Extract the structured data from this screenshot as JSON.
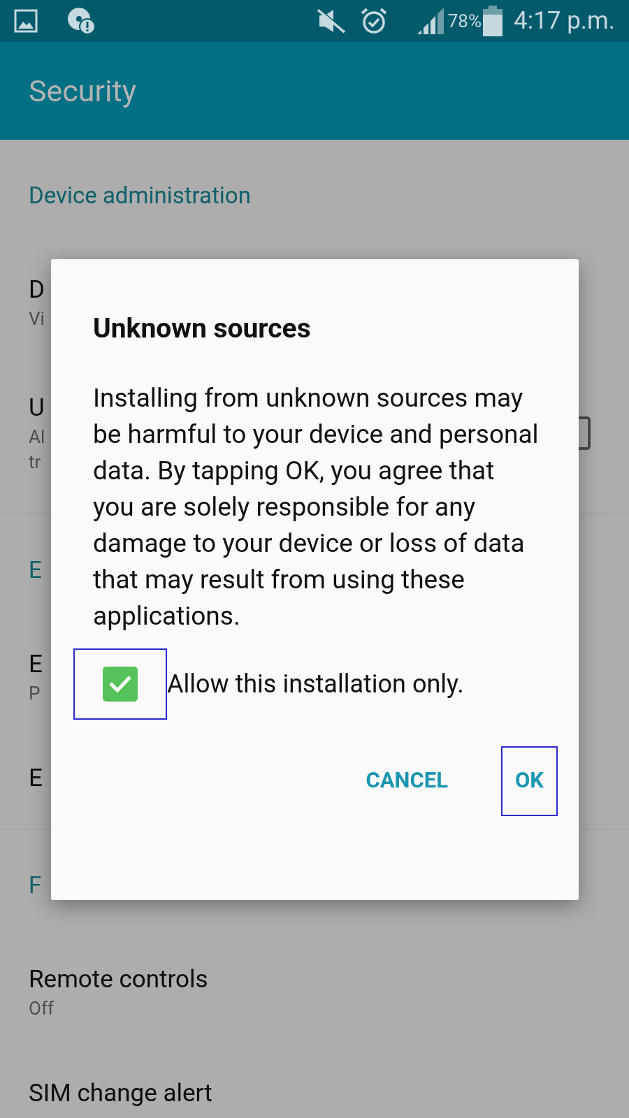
{
  "status_bar": {
    "battery": "78%",
    "time": "4:17 p.m."
  },
  "app_bar": {
    "title": "Security"
  },
  "settings": [
    {
      "kind": "header",
      "title": "Device administration"
    },
    {
      "kind": "row",
      "title": "D",
      "subtitle": "Vi"
    },
    {
      "kind": "checkbox-row",
      "title": "U",
      "subtitle_lines": [
        "Al",
        "tr"
      ],
      "checked": false
    },
    {
      "kind": "divider"
    },
    {
      "kind": "header",
      "title": "E"
    },
    {
      "kind": "row",
      "title": "E",
      "subtitle": "P"
    },
    {
      "kind": "row",
      "title": "E"
    },
    {
      "kind": "divider"
    },
    {
      "kind": "header",
      "title": "F"
    },
    {
      "kind": "row",
      "title": "Remote controls",
      "subtitle": "Off"
    },
    {
      "kind": "row",
      "title": "SIM change alert"
    }
  ],
  "dialog": {
    "title": "Unknown sources",
    "message": "Installing from unknown sources may be harmful to your device and personal data. By tapping OK, you agree that you are solely responsible for any damage to your device or loss of data that may result from using these applications.",
    "checkbox": {
      "label": "Allow this installation only.",
      "checked": true,
      "highlighted": true
    },
    "buttons": [
      {
        "label": "CANCEL",
        "highlighted": false
      },
      {
        "label": "OK",
        "highlighted": true
      }
    ]
  }
}
